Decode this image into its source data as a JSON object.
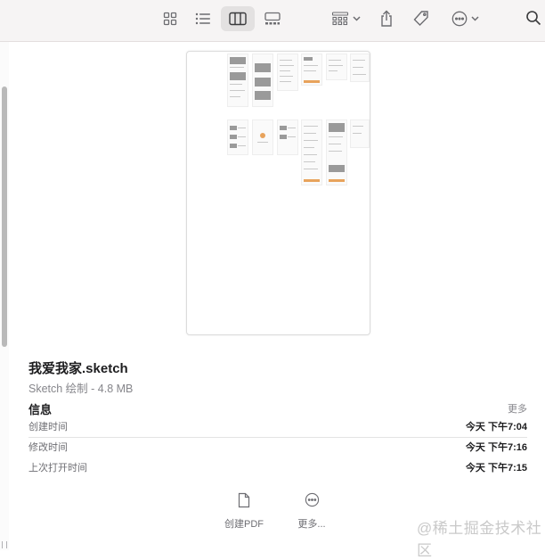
{
  "toolbar": {
    "buttons": [
      {
        "name": "icon-view-button",
        "icon": "grid-icon"
      },
      {
        "name": "list-view-button",
        "icon": "list-icon"
      },
      {
        "name": "column-view-button",
        "icon": "columns-icon",
        "active": true
      },
      {
        "name": "gallery-view-button",
        "icon": "gallery-icon"
      },
      {
        "name": "group-button",
        "icon": "group-grid-icon"
      },
      {
        "name": "share-button",
        "icon": "share-icon"
      },
      {
        "name": "tag-button",
        "icon": "tag-icon"
      },
      {
        "name": "more-actions-button",
        "icon": "ellipsis-circle-icon"
      },
      {
        "name": "search-button",
        "icon": "search-icon"
      }
    ]
  },
  "file": {
    "name": "我爱我家.sketch",
    "subtitle": "Sketch 绘制 - 4.8 MB"
  },
  "info": {
    "title": "信息",
    "more": "更多",
    "rows": [
      {
        "label": "创建时间",
        "value": "今天 下午7:04"
      },
      {
        "label": "修改时间",
        "value": "今天 下午7:16"
      },
      {
        "label": "上次打开时间",
        "value": "今天 下午7:15"
      }
    ]
  },
  "actions": {
    "create_pdf": "创建PDF",
    "more": "更多..."
  },
  "watermark": "@稀土掘金技术社区",
  "colors": {
    "toolbar_bg": "#f6f4f4",
    "active_button_bg": "#e3e1e1",
    "icon_gray": "#6c6c70",
    "preview_accent": "#e8a35c"
  }
}
